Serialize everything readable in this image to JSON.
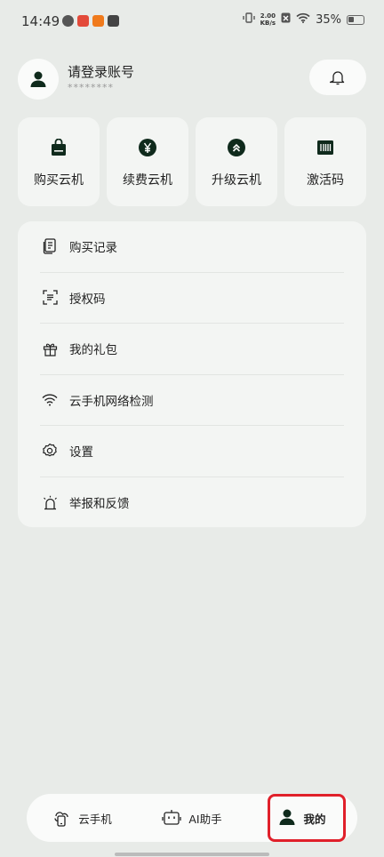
{
  "status_bar": {
    "time": "14:49",
    "net_speed_value": "2.00",
    "net_speed_unit": "KB/s",
    "battery": "35%"
  },
  "profile": {
    "name": "请登录账号",
    "id_masked": "********"
  },
  "quick_actions": [
    {
      "label": "购买云机",
      "icon": "shopping-bag-icon"
    },
    {
      "label": "续费云机",
      "icon": "yen-coin-icon"
    },
    {
      "label": "升级云机",
      "icon": "upgrade-icon"
    },
    {
      "label": "激活码",
      "icon": "barcode-icon"
    }
  ],
  "menu": [
    {
      "label": "购买记录",
      "icon": "document-icon"
    },
    {
      "label": "授权码",
      "icon": "scan-icon"
    },
    {
      "label": "我的礼包",
      "icon": "gift-icon"
    },
    {
      "label": "云手机网络检测",
      "icon": "wifi-icon"
    },
    {
      "label": "设置",
      "icon": "gear-icon"
    },
    {
      "label": "举报和反馈",
      "icon": "alarm-icon"
    }
  ],
  "bottom_nav": [
    {
      "label": "云手机",
      "icon": "cloud-phone-icon",
      "active": false
    },
    {
      "label": "AI助手",
      "icon": "robot-icon",
      "active": false
    },
    {
      "label": "我的",
      "icon": "person-icon",
      "active": true
    }
  ],
  "colors": {
    "background": "#e8ebe8",
    "card": "#f3f5f3",
    "icon_dark": "#0f2a1c",
    "highlight": "#e0202a"
  }
}
